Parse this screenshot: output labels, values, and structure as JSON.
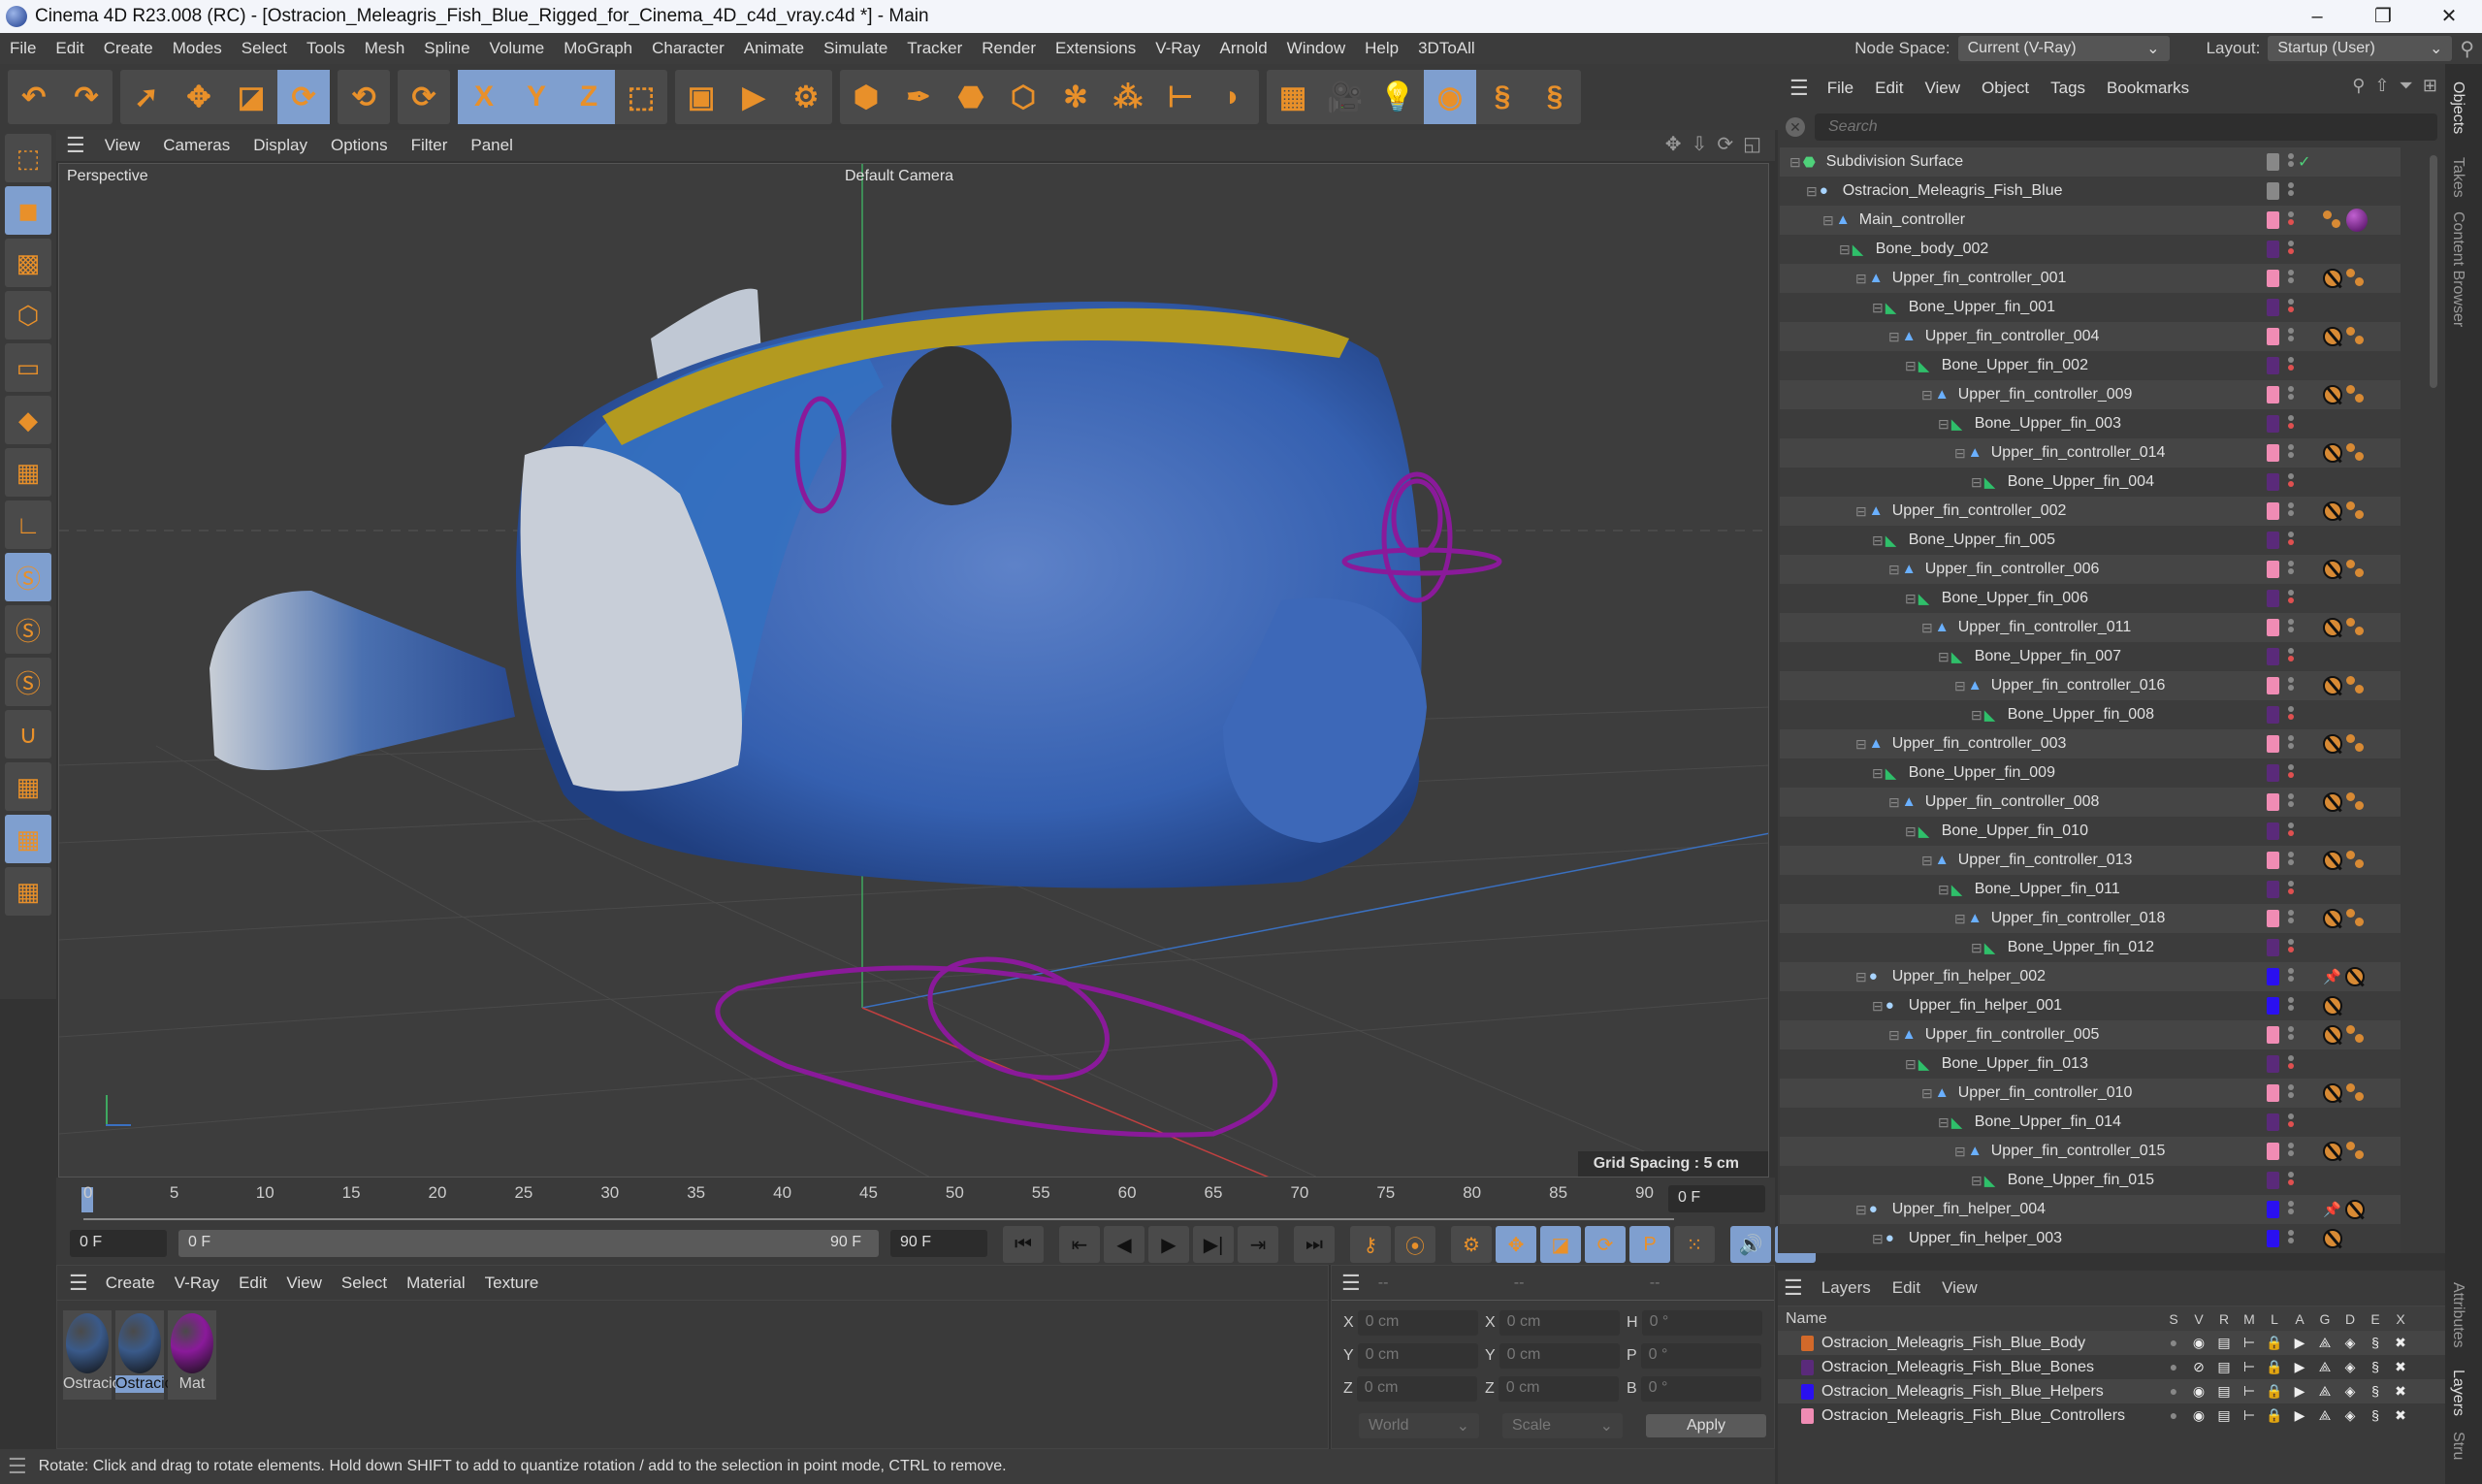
{
  "window": {
    "title": "Cinema 4D R23.008 (RC) - [Ostracion_Meleagris_Fish_Blue_Rigged_for_Cinema_4D_c4d_vray.c4d *] - Main",
    "controls": [
      "–",
      "❐",
      "✕"
    ]
  },
  "menubar": {
    "items": [
      "File",
      "Edit",
      "Create",
      "Modes",
      "Select",
      "Tools",
      "Mesh",
      "Spline",
      "Volume",
      "MoGraph",
      "Character",
      "Animate",
      "Simulate",
      "Tracker",
      "Render",
      "Extensions",
      "V-Ray",
      "Arnold",
      "Window",
      "Help",
      "3DToAll"
    ],
    "node_space_label": "Node Space:",
    "node_space_value": "Current (V-Ray)",
    "layout_label": "Layout:",
    "layout_value": "Startup (User)"
  },
  "toolbar": {
    "groups": [
      [
        {
          "icon": "undo-icon",
          "glyph": "↶"
        },
        {
          "icon": "redo-icon",
          "glyph": "↷"
        }
      ],
      [
        {
          "icon": "select-icon",
          "glyph": "➚"
        },
        {
          "icon": "move-icon",
          "glyph": "✥"
        },
        {
          "icon": "scale-icon",
          "glyph": "◪"
        },
        {
          "icon": "rotate-icon",
          "glyph": "⟳",
          "active": true
        }
      ],
      [
        {
          "icon": "psr-icon",
          "glyph": "⟲"
        }
      ],
      [
        {
          "icon": "recent-tool-icon",
          "glyph": "⟳"
        }
      ],
      [
        {
          "icon": "x-axis-icon",
          "glyph": "X",
          "active": true
        },
        {
          "icon": "y-axis-icon",
          "glyph": "Y",
          "active": true
        },
        {
          "icon": "z-axis-icon",
          "glyph": "Z",
          "active": true
        },
        {
          "icon": "coordinate-system-icon",
          "glyph": "⬚"
        }
      ],
      [
        {
          "icon": "render-view-icon",
          "glyph": "▣"
        },
        {
          "icon": "render-picture-viewer-icon",
          "glyph": "▶"
        },
        {
          "icon": "render-settings-icon",
          "glyph": "⚙"
        }
      ],
      [
        {
          "icon": "cube-icon",
          "glyph": "⬢"
        },
        {
          "icon": "pen-icon",
          "glyph": "✒"
        },
        {
          "icon": "subdivision-icon",
          "glyph": "⬣"
        },
        {
          "icon": "extrude-icon",
          "glyph": "⬡"
        },
        {
          "icon": "cloner-icon",
          "glyph": "✻"
        },
        {
          "icon": "mograph-icon",
          "glyph": "⁂"
        },
        {
          "icon": "deformer-icon",
          "glyph": "⊢"
        },
        {
          "icon": "field-icon",
          "glyph": "◗"
        }
      ],
      [
        {
          "icon": "floor-icon",
          "glyph": "▦"
        },
        {
          "icon": "camera-icon",
          "glyph": "🎥"
        },
        {
          "icon": "light-icon",
          "glyph": "💡"
        },
        {
          "icon": "vray-icon",
          "glyph": "◉",
          "active": true
        },
        {
          "icon": "python-icon",
          "glyph": "§"
        },
        {
          "icon": "python-icon-2",
          "glyph": "§"
        }
      ]
    ]
  },
  "left_tools": [
    {
      "icon": "make-editable-icon"
    },
    {
      "icon": "model-mode-icon",
      "active": true
    },
    {
      "icon": "texture-mode-icon"
    },
    {
      "icon": "points-mode-icon"
    },
    {
      "icon": "edges-mode-icon"
    },
    {
      "icon": "polygons-mode-icon"
    },
    {
      "icon": "uv-mode-icon"
    },
    {
      "icon": "axis-mode-icon"
    },
    {
      "icon": "solo-off-icon",
      "active": true
    },
    {
      "icon": "solo-single-icon"
    },
    {
      "icon": "solo-hierarchy-icon"
    },
    {
      "icon": "snap-icon"
    },
    {
      "icon": "workplane-icon"
    },
    {
      "icon": "locked-workplane-icon",
      "active": true
    },
    {
      "icon": "workplane-align-icon"
    }
  ],
  "viewport": {
    "menu": [
      "View",
      "Cameras",
      "Display",
      "Options",
      "Filter",
      "Panel"
    ],
    "projection": "Perspective",
    "camera": "Default Camera",
    "grid_spacing": "Grid Spacing : 5 cm"
  },
  "timeline": {
    "ticks": [
      "0",
      "5",
      "10",
      "15",
      "20",
      "25",
      "30",
      "35",
      "40",
      "45",
      "50",
      "55",
      "60",
      "65",
      "70",
      "75",
      "80",
      "85",
      "90"
    ],
    "current_frame": "0 F",
    "start_field": "0 F",
    "range_start": "0 F",
    "range_end": "90 F",
    "end_field": "90 F",
    "playhead_frame": 0,
    "max_frame": 90
  },
  "transport": [
    {
      "icon": "goto-start-icon",
      "glyph": "⏮"
    },
    {
      "icon": "prev-key-icon",
      "glyph": "⇤"
    },
    {
      "icon": "prev-frame-icon",
      "glyph": "◀"
    },
    {
      "icon": "play-icon",
      "glyph": "▶"
    },
    {
      "icon": "next-frame-icon",
      "glyph": "▶|"
    },
    {
      "icon": "next-key-icon",
      "glyph": "⇥"
    },
    {
      "icon": "goto-end-icon",
      "glyph": "⏭"
    },
    {
      "icon": "record-keys-icon",
      "glyph": "⚷"
    },
    {
      "icon": "autokey-icon",
      "glyph": "⦿"
    },
    {
      "icon": "keyframe-settings-icon",
      "glyph": "⚙"
    },
    {
      "icon": "key-position-icon",
      "glyph": "✥",
      "active": true
    },
    {
      "icon": "key-scale-icon",
      "glyph": "◪",
      "active": true
    },
    {
      "icon": "key-rotation-icon",
      "glyph": "⟳",
      "active": true
    },
    {
      "icon": "key-param-icon",
      "glyph": "P",
      "active": true
    },
    {
      "icon": "key-pla-icon",
      "glyph": "⁙"
    },
    {
      "icon": "sound-icon",
      "glyph": "🔊",
      "active": true
    },
    {
      "icon": "film-icon",
      "glyph": "🎞",
      "active": true
    }
  ],
  "materials": {
    "menu": [
      "Create",
      "V-Ray",
      "Edit",
      "View",
      "Select",
      "Material",
      "Texture"
    ],
    "items": [
      {
        "name": "Ostracio",
        "color": "#3a5a8a",
        "selected": false
      },
      {
        "name": "Ostracio",
        "color": "#3a5a8a",
        "selected": true
      },
      {
        "name": "Mat",
        "color": "#8a1a9a",
        "selected": false
      }
    ]
  },
  "coordinates": {
    "headers": [
      "--",
      "--",
      "--"
    ],
    "rows": [
      {
        "l1": "X",
        "v1": "0 cm",
        "l2": "X",
        "v2": "0 cm",
        "l3": "H",
        "v3": "0 °"
      },
      {
        "l1": "Y",
        "v1": "0 cm",
        "l2": "Y",
        "v2": "0 cm",
        "l3": "P",
        "v3": "0 °"
      },
      {
        "l1": "Z",
        "v1": "0 cm",
        "l2": "Z",
        "v2": "0 cm",
        "l3": "B",
        "v3": "0 °"
      }
    ],
    "space": "World",
    "mode": "Scale",
    "apply": "Apply"
  },
  "status": "Rotate: Click and drag to rotate elements. Hold down SHIFT to add to quantize rotation / add to the selection in point mode, CTRL to remove.",
  "object_manager": {
    "menu": [
      "File",
      "Edit",
      "View",
      "Object",
      "Tags",
      "Bookmarks"
    ],
    "search_placeholder": "Search",
    "rows": [
      {
        "name": "Subdivision Surface",
        "depth": 0,
        "type": "subdiv",
        "layer": "#888888",
        "tags": [],
        "check": true
      },
      {
        "name": "Ostracion_Meleagris_Fish_Blue",
        "depth": 1,
        "type": "null",
        "layer": "#888888",
        "tags": []
      },
      {
        "name": "Main_controller",
        "depth": 2,
        "type": "ctrl",
        "layer": "#f08cb4",
        "tags": [
          "ik",
          "material"
        ]
      },
      {
        "name": "Bone_body_002",
        "depth": 3,
        "type": "bone",
        "layer": "#5a2a7a",
        "tags": []
      },
      {
        "name": "Upper_fin_controller_001",
        "depth": 4,
        "type": "ctrl",
        "layer": "#f08cb4",
        "tags": [
          "constraint",
          "ik"
        ]
      },
      {
        "name": "Bone_Upper_fin_001",
        "depth": 5,
        "type": "bone",
        "layer": "#5a2a7a",
        "tags": []
      },
      {
        "name": "Upper_fin_controller_004",
        "depth": 6,
        "type": "ctrl",
        "layer": "#f08cb4",
        "tags": [
          "constraint",
          "ik"
        ]
      },
      {
        "name": "Bone_Upper_fin_002",
        "depth": 7,
        "type": "bone",
        "layer": "#5a2a7a",
        "tags": []
      },
      {
        "name": "Upper_fin_controller_009",
        "depth": 8,
        "type": "ctrl",
        "layer": "#f08cb4",
        "tags": [
          "constraint",
          "ik"
        ]
      },
      {
        "name": "Bone_Upper_fin_003",
        "depth": 9,
        "type": "bone",
        "layer": "#5a2a7a",
        "tags": []
      },
      {
        "name": "Upper_fin_controller_014",
        "depth": 10,
        "type": "ctrl",
        "layer": "#f08cb4",
        "tags": [
          "constraint",
          "ik"
        ]
      },
      {
        "name": "Bone_Upper_fin_004",
        "depth": 11,
        "type": "bone",
        "layer": "#5a2a7a",
        "tags": []
      },
      {
        "name": "Upper_fin_controller_002",
        "depth": 4,
        "type": "ctrl",
        "layer": "#f08cb4",
        "tags": [
          "constraint",
          "ik"
        ]
      },
      {
        "name": "Bone_Upper_fin_005",
        "depth": 5,
        "type": "bone",
        "layer": "#5a2a7a",
        "tags": []
      },
      {
        "name": "Upper_fin_controller_006",
        "depth": 6,
        "type": "ctrl",
        "layer": "#f08cb4",
        "tags": [
          "constraint",
          "ik"
        ]
      },
      {
        "name": "Bone_Upper_fin_006",
        "depth": 7,
        "type": "bone",
        "layer": "#5a2a7a",
        "tags": []
      },
      {
        "name": "Upper_fin_controller_011",
        "depth": 8,
        "type": "ctrl",
        "layer": "#f08cb4",
        "tags": [
          "constraint",
          "ik"
        ]
      },
      {
        "name": "Bone_Upper_fin_007",
        "depth": 9,
        "type": "bone",
        "layer": "#5a2a7a",
        "tags": []
      },
      {
        "name": "Upper_fin_controller_016",
        "depth": 10,
        "type": "ctrl",
        "layer": "#f08cb4",
        "tags": [
          "constraint",
          "ik"
        ]
      },
      {
        "name": "Bone_Upper_fin_008",
        "depth": 11,
        "type": "bone",
        "layer": "#5a2a7a",
        "tags": []
      },
      {
        "name": "Upper_fin_controller_003",
        "depth": 4,
        "type": "ctrl",
        "layer": "#f08cb4",
        "tags": [
          "constraint",
          "ik"
        ]
      },
      {
        "name": "Bone_Upper_fin_009",
        "depth": 5,
        "type": "bone",
        "layer": "#5a2a7a",
        "tags": []
      },
      {
        "name": "Upper_fin_controller_008",
        "depth": 6,
        "type": "ctrl",
        "layer": "#f08cb4",
        "tags": [
          "constraint",
          "ik"
        ]
      },
      {
        "name": "Bone_Upper_fin_010",
        "depth": 7,
        "type": "bone",
        "layer": "#5a2a7a",
        "tags": []
      },
      {
        "name": "Upper_fin_controller_013",
        "depth": 8,
        "type": "ctrl",
        "layer": "#f08cb4",
        "tags": [
          "constraint",
          "ik"
        ]
      },
      {
        "name": "Bone_Upper_fin_011",
        "depth": 9,
        "type": "bone",
        "layer": "#5a2a7a",
        "tags": []
      },
      {
        "name": "Upper_fin_controller_018",
        "depth": 10,
        "type": "ctrl",
        "layer": "#f08cb4",
        "tags": [
          "constraint",
          "ik"
        ]
      },
      {
        "name": "Bone_Upper_fin_012",
        "depth": 11,
        "type": "bone",
        "layer": "#5a2a7a",
        "tags": []
      },
      {
        "name": "Upper_fin_helper_002",
        "depth": 4,
        "type": "null",
        "layer": "#2a10f0",
        "tags": [
          "psr",
          "constraint"
        ]
      },
      {
        "name": "Upper_fin_helper_001",
        "depth": 5,
        "type": "null",
        "layer": "#2a10f0",
        "tags": [
          "constraint"
        ]
      },
      {
        "name": "Upper_fin_controller_005",
        "depth": 6,
        "type": "ctrl",
        "layer": "#f08cb4",
        "tags": [
          "constraint",
          "ik"
        ]
      },
      {
        "name": "Bone_Upper_fin_013",
        "depth": 7,
        "type": "bone",
        "layer": "#5a2a7a",
        "tags": []
      },
      {
        "name": "Upper_fin_controller_010",
        "depth": 8,
        "type": "ctrl",
        "layer": "#f08cb4",
        "tags": [
          "constraint",
          "ik"
        ]
      },
      {
        "name": "Bone_Upper_fin_014",
        "depth": 9,
        "type": "bone",
        "layer": "#5a2a7a",
        "tags": []
      },
      {
        "name": "Upper_fin_controller_015",
        "depth": 10,
        "type": "ctrl",
        "layer": "#f08cb4",
        "tags": [
          "constraint",
          "ik"
        ]
      },
      {
        "name": "Bone_Upper_fin_015",
        "depth": 11,
        "type": "bone",
        "layer": "#5a2a7a",
        "tags": []
      },
      {
        "name": "Upper_fin_helper_004",
        "depth": 4,
        "type": "null",
        "layer": "#2a10f0",
        "tags": [
          "psr",
          "constraint"
        ]
      },
      {
        "name": "Upper_fin_helper_003",
        "depth": 5,
        "type": "null",
        "layer": "#2a10f0",
        "tags": [
          "constraint"
        ]
      }
    ]
  },
  "layers": {
    "menu": [
      "Layers",
      "Edit",
      "View"
    ],
    "columns": [
      "Name",
      "S",
      "V",
      "R",
      "M",
      "L",
      "A",
      "G",
      "D",
      "E",
      "X"
    ],
    "items": [
      {
        "name": "Ostracion_Meleagris_Fish_Blue_Body",
        "color": "#d2692a",
        "visible": true
      },
      {
        "name": "Ostracion_Meleagris_Fish_Blue_Bones",
        "color": "#5a2a7a",
        "visible": false
      },
      {
        "name": "Ostracion_Meleagris_Fish_Blue_Helpers",
        "color": "#2a10f0",
        "visible": true
      },
      {
        "name": "Ostracion_Meleagris_Fish_Blue_Controllers",
        "color": "#f08cb4",
        "visible": true
      }
    ]
  },
  "right_tabs": {
    "top": [
      "Objects",
      "Takes",
      "Content Browser"
    ],
    "bottom": [
      "Attributes",
      "Layers",
      "Stru"
    ]
  },
  "colors": {
    "accent": "#7f9fcf",
    "panel": "#3a3a3a",
    "rig_controls": "#8a1a9a"
  }
}
